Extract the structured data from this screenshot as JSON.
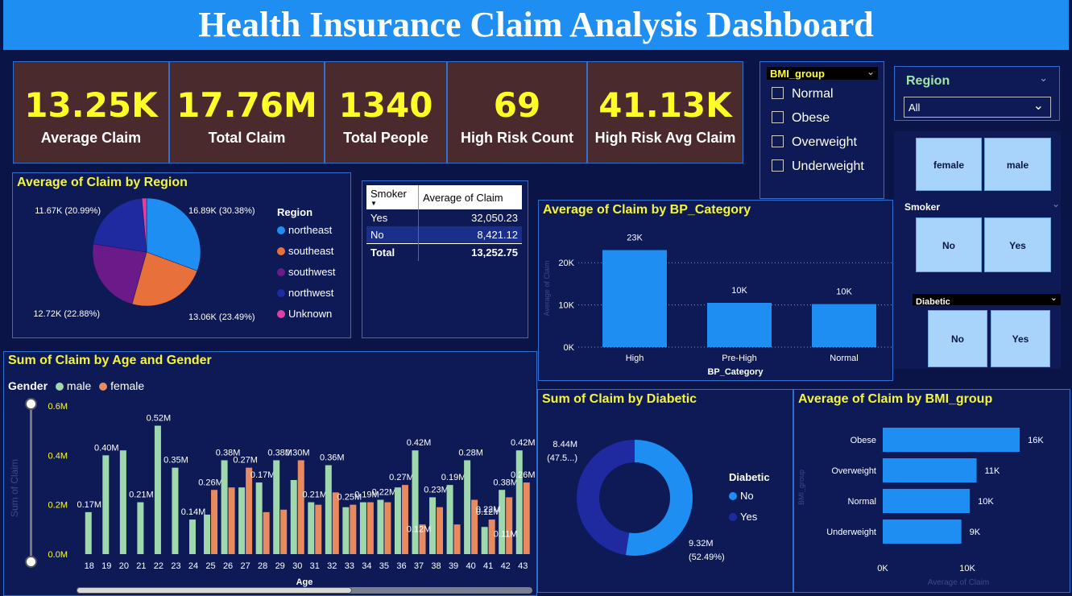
{
  "title": "Health Insurance Claim Analysis Dashboard",
  "kpis": [
    {
      "value": "13.25K",
      "label": "Average Claim"
    },
    {
      "value": "17.76M",
      "label": "Total Claim"
    },
    {
      "value": "1340",
      "label": "Total People"
    },
    {
      "value": "69",
      "label": "High Risk Count"
    },
    {
      "value": "41.13K",
      "label": "High Risk Avg Claim"
    }
  ],
  "bmi_slicer": {
    "title": "BMI_group",
    "items": [
      "Normal",
      "Obese",
      "Overweight",
      "Underweight"
    ]
  },
  "region_slicer": {
    "title": "Region",
    "selected": "All"
  },
  "gender_slicer": {
    "items": [
      "female",
      "male"
    ]
  },
  "smoker_slicer": {
    "title": "Smoker",
    "items": [
      "No",
      "Yes"
    ]
  },
  "diabetic_slicer": {
    "title": "Diabetic",
    "items": [
      "No",
      "Yes"
    ]
  },
  "smoker_table": {
    "headers": [
      "Smoker",
      "Average of Claim"
    ],
    "rows": [
      [
        "Yes",
        "32,050.23"
      ],
      [
        "No",
        "8,421.12"
      ]
    ],
    "total": [
      "Total",
      "13,252.75"
    ]
  },
  "colors": {
    "blue": "#1e8ef2",
    "orange": "#e8703a",
    "purple": "#6b1a8a",
    "navy": "#1f2aa0",
    "pink": "#e040a0",
    "mint": "#9fd8ad",
    "salmon": "#e88a5e",
    "yellow": "#fdfd28"
  },
  "chart_data": [
    {
      "type": "pie",
      "title": "Average of Claim by Region",
      "legend_title": "Region",
      "slices": [
        {
          "name": "northeast",
          "value": 16.89,
          "label": "16.89K (30.38%)"
        },
        {
          "name": "southeast",
          "value": 13.06,
          "label": "13.06K (23.49%)"
        },
        {
          "name": "southwest",
          "value": 12.72,
          "label": "12.72K (22.88%)"
        },
        {
          "name": "northwest",
          "value": 11.67,
          "label": "11.67K (20.99%)"
        },
        {
          "name": "Unknown",
          "value": 0.78,
          "label": ""
        }
      ]
    },
    {
      "type": "bar",
      "title": "Average of Claim by BP_Category",
      "xlabel": "BP_Category",
      "ylabel": "Average of Claim",
      "categories": [
        "High",
        "Pre-High",
        "Normal"
      ],
      "values": [
        23,
        10.5,
        10.2
      ],
      "data_labels": [
        "23K",
        "10K",
        "10K"
      ],
      "yticks": [
        "0K",
        "10K",
        "20K"
      ],
      "ylim": [
        0,
        25
      ]
    },
    {
      "type": "bar",
      "title": "Sum of Claim by Age and Gender",
      "xlabel": "Age",
      "ylabel": "Sum of Claim",
      "legend_title": "Gender",
      "categories": [
        "18",
        "19",
        "20",
        "21",
        "22",
        "23",
        "24",
        "25",
        "26",
        "27",
        "28",
        "29",
        "30",
        "31",
        "32",
        "33",
        "34",
        "35",
        "36",
        "37",
        "38",
        "39",
        "40",
        "41",
        "42",
        "43"
      ],
      "series": [
        {
          "name": "male",
          "values": [
            0.17,
            0.4,
            0.42,
            0.21,
            0.52,
            0.35,
            0.14,
            0.16,
            0.38,
            0.27,
            0.29,
            0.38,
            0.3,
            0.21,
            0.36,
            0.19,
            0.21,
            0.22,
            0.27,
            0.42,
            0.23,
            0.28,
            0.38,
            0.11,
            0.26,
            0.42
          ]
        },
        {
          "name": "female",
          "values": [
            null,
            null,
            null,
            null,
            null,
            null,
            null,
            0.26,
            0.27,
            0.35,
            0.17,
            0.18,
            0.38,
            0.2,
            0.25,
            0.2,
            0.21,
            0.21,
            0.28,
            0.12,
            0.19,
            0.12,
            0.22,
            0.14,
            0.23,
            0.29
          ]
        }
      ],
      "data_labels": {
        "18": "0.17M",
        "19": "0.40M",
        "21": "0.21M",
        "22": "0.52M",
        "23": "0.35M",
        "24": "0.14M",
        "25": "0.26M",
        "26": "0.38M",
        "27": "0.27M",
        "28": "0.17M",
        "29": "0.38M",
        "30": "0.30M",
        "31": "0.21M",
        "32": "0.36M",
        "33": "0.25M",
        "34": "0.19M",
        "35": "0.22M",
        "36": "0.27M",
        "37": "0.42M",
        "38": "0.23M",
        "39": "0.19M",
        "40": "0.28M",
        "41": "0.12M",
        "42": "0.38M",
        "43": "0.42M"
      },
      "extra_labels": [
        "0.12M",
        "0.22M",
        "0.11M",
        "0.26M"
      ],
      "yticks": [
        "0.0M",
        "0.2M",
        "0.4M",
        "0.6M"
      ],
      "ylim": [
        0,
        0.6
      ]
    },
    {
      "type": "pie",
      "title": "Sum of Claim by Diabetic",
      "legend_title": "Diabetic",
      "slices": [
        {
          "name": "No",
          "value": 9.32,
          "label": "9.32M",
          "pct": "(52.49%)"
        },
        {
          "name": "Yes",
          "value": 8.44,
          "label": "8.44M",
          "pct": "(47.5...)"
        }
      ]
    },
    {
      "type": "bar",
      "title": "Average of Claim by BMI_group",
      "xlabel": "Average of Claim",
      "ylabel": "BMI_group",
      "categories": [
        "Obese",
        "Overweight",
        "Normal",
        "Underweight"
      ],
      "values": [
        16.2,
        11.1,
        10.3,
        9.3
      ],
      "data_labels": [
        "16K",
        "11K",
        "10K",
        "9K"
      ],
      "xticks": [
        "0K",
        "10K"
      ],
      "xlim": [
        0,
        18
      ]
    }
  ]
}
